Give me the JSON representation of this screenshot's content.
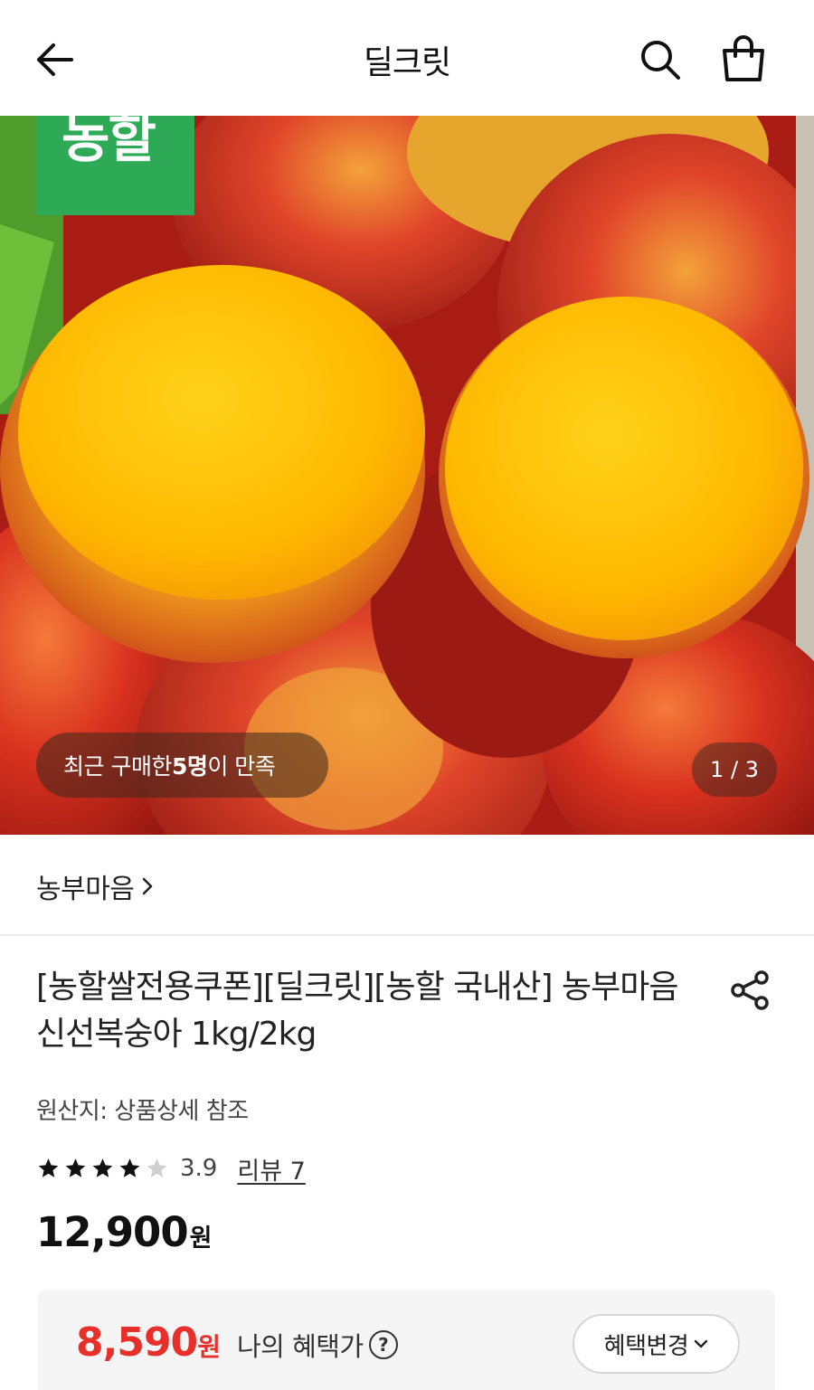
{
  "header": {
    "title": "딜크릿"
  },
  "hero": {
    "brand_badge": "농할",
    "satisfaction_prefix": "최근 구매한 ",
    "satisfaction_count": "5명",
    "satisfaction_suffix": "이 만족",
    "counter": "1 / 3"
  },
  "seller": {
    "name": "농부마음",
    "chevron": "›"
  },
  "product": {
    "title": "[농할쌀전용쿠폰][딜크릿][농할 국내산] 농부마음 신선복숭아 1kg/2kg",
    "origin": "원산지: 상품상세 참조",
    "rating": "3.9",
    "rating_stars": 4,
    "review_link": "리뷰 7",
    "price_amount": "12,900",
    "price_unit": "원"
  },
  "benefit": {
    "price_amount": "8,590",
    "price_unit": "원",
    "label": "나의 혜택가",
    "help": "?",
    "change_button": "혜택변경"
  },
  "colors": {
    "brand_green": "#2eaa56",
    "benefit_red": "#e8302a"
  }
}
